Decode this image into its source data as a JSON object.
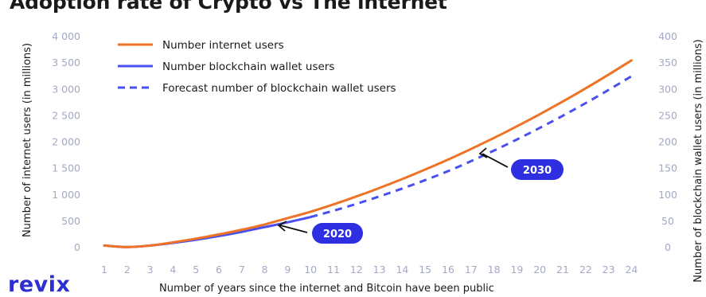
{
  "title": "Adoption rate of Crypto vs The internet",
  "logo": "revix",
  "colors": {
    "internet": "#ee7326",
    "blockchain": "#4a4ff0",
    "badge": "#2d2fe0",
    "tick": "#a4a8c4"
  },
  "chart_data": {
    "type": "line",
    "xlabel": "Number of years since the internet and Bitcoin have been public",
    "ylabel_left": "Number of internet users (in millions)",
    "ylabel_right": "Number of blockchain wallet users (in millions)",
    "x": [
      1,
      2,
      3,
      4,
      5,
      6,
      7,
      8,
      9,
      10,
      11,
      12,
      13,
      14,
      15,
      16,
      17,
      18,
      19,
      20,
      21,
      22,
      23,
      24
    ],
    "x_ticks": [
      "1",
      "2",
      "3",
      "4",
      "5",
      "6",
      "7",
      "8",
      "9",
      "10",
      "11",
      "12",
      "13",
      "14",
      "15",
      "16",
      "17",
      "18",
      "19",
      "20",
      "21",
      "22",
      "23",
      "24"
    ],
    "ylim_left": [
      0,
      4000
    ],
    "y_ticks_left": [
      "0",
      "500",
      "1 000",
      "1 500",
      "2 000",
      "2 500",
      "3 000",
      "3 500",
      "4 000"
    ],
    "ylim_right": [
      0,
      400
    ],
    "y_ticks_right": [
      "0",
      "50",
      "100",
      "150",
      "200",
      "250",
      "300",
      "350",
      "400"
    ],
    "series": [
      {
        "name": "Number internet users",
        "axis": "left",
        "style": "solid",
        "x": [
          1,
          2,
          3,
          4,
          5,
          6,
          7,
          8,
          9,
          10,
          11,
          12,
          13,
          14,
          15,
          16,
          17,
          18,
          19,
          20,
          21,
          22,
          23,
          24
        ],
        "values": [
          40,
          10,
          40,
          100,
          170,
          250,
          340,
          440,
          560,
          680,
          820,
          970,
          1130,
          1300,
          1480,
          1670,
          1870,
          2080,
          2300,
          2530,
          2770,
          3020,
          3280,
          3550
        ]
      },
      {
        "name": "Number blockchain wallet users",
        "axis": "right",
        "style": "solid",
        "x": [
          1,
          2,
          3,
          4,
          5,
          6,
          7,
          8,
          9,
          10
        ],
        "values": [
          4,
          1,
          4,
          9,
          15,
          22,
          30,
          39,
          48,
          58
        ]
      },
      {
        "name": "Forecast number of blockchain wallet users",
        "axis": "right",
        "style": "dashed",
        "x": [
          10,
          11,
          12,
          13,
          14,
          15,
          16,
          17,
          18,
          19,
          20,
          21,
          22,
          23,
          24
        ],
        "values": [
          58,
          70,
          83,
          97,
          112,
          128,
          145,
          164,
          184,
          205,
          227,
          250,
          274,
          299,
          325
        ]
      }
    ],
    "annotations": [
      {
        "label": "2020",
        "x": 10,
        "value": 58,
        "axis": "right"
      },
      {
        "label": "2030",
        "x": 18,
        "value": 184,
        "axis": "right"
      }
    ]
  }
}
